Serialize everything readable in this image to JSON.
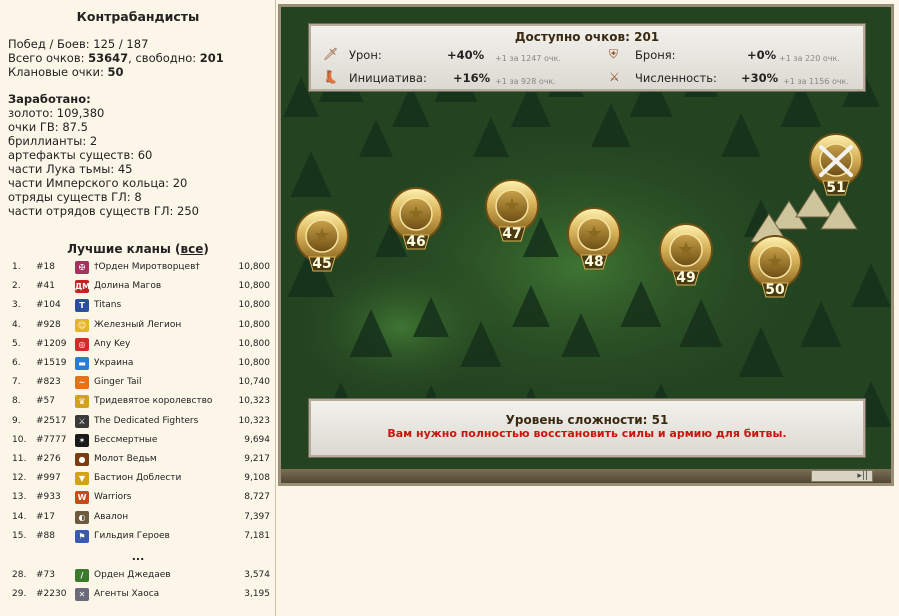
{
  "clan_name": "Контрабандисты",
  "stats": {
    "wins_label": "Побед / Боев:",
    "wins_value": "125 / 187",
    "total_label": "Всего очков:",
    "total_value": "53647",
    "free_label": ", свободно:",
    "free_value": "201",
    "clan_points_label": "Клановые очки:",
    "clan_points_value": "50"
  },
  "earned": {
    "title": "Заработано:",
    "lines": [
      "золото: 109,380",
      "очки ГВ: 87.5",
      "бриллианты: 2",
      "артефакты существ: 60",
      "части Лука тьмы: 45",
      "части Имперского кольца: 20",
      "отряды существ ГЛ: 8",
      "части отрядов существ ГЛ: 250"
    ]
  },
  "clans": {
    "title_prefix": "Лучшие кланы (",
    "title_link": "все",
    "title_suffix": ")",
    "ellipsis": "...",
    "rows": [
      {
        "n": "1.",
        "id": "#18",
        "name": "†Орден Миротворцев†",
        "score": "10,800",
        "color": "#a0345c",
        "glyph": "✠"
      },
      {
        "n": "2.",
        "id": "#41",
        "name": "Долина Магов",
        "score": "10,800",
        "color": "#c62020",
        "glyph": "ДМ"
      },
      {
        "n": "3.",
        "id": "#104",
        "name": "Titans",
        "score": "10,800",
        "color": "#2a4fa0",
        "glyph": "T"
      },
      {
        "n": "4.",
        "id": "#928",
        "name": "Железный Легион",
        "score": "10,800",
        "color": "#e6b526",
        "glyph": "☺"
      },
      {
        "n": "5.",
        "id": "#1209",
        "name": "Any Key",
        "score": "10,800",
        "color": "#d62a2a",
        "glyph": "◎"
      },
      {
        "n": "6.",
        "id": "#1519",
        "name": "Украина",
        "score": "10,800",
        "color": "#2a7ad6",
        "glyph": "▬"
      },
      {
        "n": "7.",
        "id": "#823",
        "name": "Ginger Tail",
        "score": "10,740",
        "color": "#e8701c",
        "glyph": "~"
      },
      {
        "n": "8.",
        "id": "#57",
        "name": "Тридевятое королевство",
        "score": "10,323",
        "color": "#d2a21a",
        "glyph": "♛"
      },
      {
        "n": "9.",
        "id": "#2517",
        "name": "The Dedicated Fighters",
        "score": "10,323",
        "color": "#3a3a3a",
        "glyph": "⚔"
      },
      {
        "n": "10.",
        "id": "#7777",
        "name": "Бессмертные",
        "score": "9,694",
        "color": "#1a1a1a",
        "glyph": "✶"
      },
      {
        "n": "11.",
        "id": "#276",
        "name": "Молот Ведьм",
        "score": "9,217",
        "color": "#7a3c10",
        "glyph": "●"
      },
      {
        "n": "12.",
        "id": "#997",
        "name": "Бастион Доблести",
        "score": "9,108",
        "color": "#d4a217",
        "glyph": "▼"
      },
      {
        "n": "13.",
        "id": "#933",
        "name": "Warriors",
        "score": "8,727",
        "color": "#c84a16",
        "glyph": "W"
      },
      {
        "n": "14.",
        "id": "#17",
        "name": "Авалон",
        "score": "7,397",
        "color": "#6e5a3e",
        "glyph": "◐"
      },
      {
        "n": "15.",
        "id": "#88",
        "name": "Гильдия Героев",
        "score": "7,181",
        "color": "#3a5ab0",
        "glyph": "⚑"
      },
      {
        "n": "28.",
        "id": "#73",
        "name": "Орден Джедаев",
        "score": "3,574",
        "color": "#3a7a2a",
        "glyph": "/"
      },
      {
        "n": "29.",
        "id": "#2230",
        "name": "Агенты Хаоса",
        "score": "3,195",
        "color": "#6a6a7a",
        "glyph": "✕"
      }
    ]
  },
  "game": {
    "points_title": "Доступно очков: 201",
    "stats": [
      {
        "label": "Урон:",
        "value": "+40%",
        "cost": "+1 за 1247 очк.",
        "icon": "sword-icon"
      },
      {
        "label": "Броня:",
        "value": "+0%",
        "cost": "+1 за 220 очк.",
        "icon": "shield-icon"
      },
      {
        "label": "Инициатива:",
        "value": "+16%",
        "cost": "+1 за 928 очк.",
        "icon": "boot-icon"
      },
      {
        "label": "Численность:",
        "value": "+30%",
        "cost": "+1 за 1156 очк.",
        "icon": "army-icon"
      }
    ],
    "difficulty": "Уровень сложности: 51",
    "warning": "Вам нужно полностью восстановить силы и армию для битвы.",
    "levels": [
      "45",
      "46",
      "47",
      "48",
      "49",
      "50",
      "51"
    ]
  },
  "colors": {
    "gold": "#d4b35a",
    "warning": "#c8160e",
    "forest": "#1f3c1c"
  }
}
